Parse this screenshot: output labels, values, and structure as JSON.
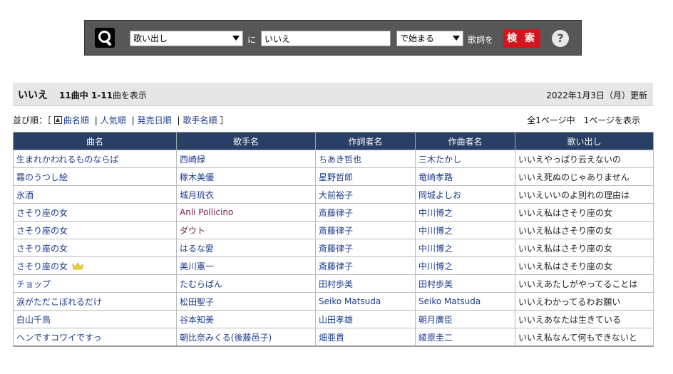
{
  "search": {
    "field_select": "歌い出し",
    "particle": "に",
    "query": "いいえ",
    "mode_select": "で始まる",
    "suffix": "歌詞を",
    "button_label": "検 索",
    "help_label": "?"
  },
  "header": {
    "query": "いいえ",
    "count_prefix": "11曲中 ",
    "count_range": "1-11",
    "count_suffix": "曲を表示",
    "updated": "2022年1月3日（月）更新"
  },
  "sort": {
    "label": "並び順：［",
    "options": [
      "曲名順",
      "人気順",
      "発売日順",
      "歌手名順"
    ],
    "close": "］"
  },
  "pageinfo": "全1ページ中　1ページを表示",
  "table": {
    "columns": [
      "曲名",
      "歌手名",
      "作詞者名",
      "作曲者名",
      "歌い出し"
    ],
    "rows": [
      [
        "生まれかわれるものならば",
        "西崎緑",
        "ちあき哲也",
        "三木たかし",
        "いいえやっぱり云えないの"
      ],
      [
        "霧のうつし絵",
        "稼木美優",
        "星野哲郎",
        "竜崎孝路",
        "いいえ死ぬのじゃありません"
      ],
      [
        "氷酒",
        "城月琉衣",
        "大前裕子",
        "岡城よしお",
        "いいえいいのよ別れの理由は"
      ],
      [
        "さそり座の女",
        "Anli Pollicino",
        "斎藤律子",
        "中川博之",
        "いいえ私はさそり座の女"
      ],
      [
        "さそり座の女",
        "ダウト",
        "斎藤律子",
        "中川博之",
        "いいえ私はさそり座の女"
      ],
      [
        "さそり座の女",
        "はるな愛",
        "斎藤律子",
        "中川博之",
        "いいえ私はさそり座の女"
      ],
      [
        "さそり座の女",
        "美川憲一",
        "斎藤律子",
        "中川博之",
        "いいえ私はさそり座の女"
      ],
      [
        "チョップ",
        "たむらぱん",
        "田村歩美",
        "田村歩美",
        "いいえあたしがやってることは"
      ],
      [
        "涙がただこぼれるだけ",
        "松田聖子",
        "Seiko Matsuda",
        "Seiko Matsuda",
        "いいえわかってるわお願い"
      ],
      [
        "白山千鳥",
        "谷本知美",
        "山田孝雄",
        "朝月廣臣",
        "いいえあなたは生きている"
      ],
      [
        "ヘンですコワイですっ",
        "朝比奈みくる(後藤邑子)",
        "畑亜貴",
        "綾原圭二",
        "いいえ私なんて何もできないと"
      ]
    ]
  },
  "colors": {
    "table_header": "#2a3f66",
    "link": "#1d3c8e",
    "search_button": "#d3151e"
  }
}
